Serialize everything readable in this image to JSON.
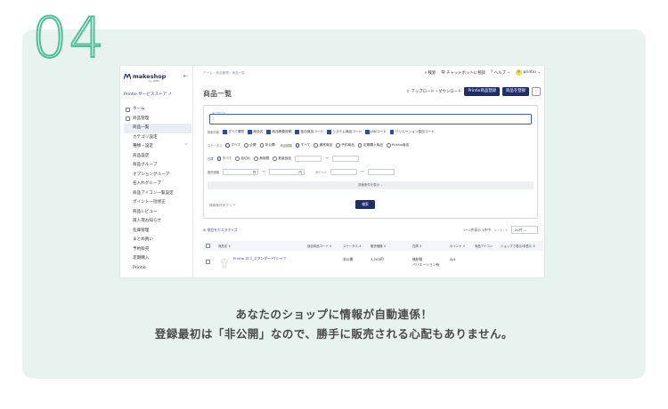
{
  "step": "04",
  "app": {
    "logo": "makeshop",
    "logo_sub": "by GMO",
    "store_link": "Printio サービスストア"
  },
  "sidebar": {
    "home": "ホーム",
    "products": "商品管理",
    "items": [
      "商品一覧",
      "カテゴリ設定",
      "種類・設定",
      "商品設定",
      "商品グループ",
      "オプショングループ",
      "名入れグループ",
      "商品アイコン一覧設定",
      "ポイント一括修正",
      "商品レビュー",
      "再入荷お知らせ",
      "在庫管理",
      "まとめ買い",
      "予約販売",
      "定期購入",
      "Printio"
    ]
  },
  "header": {
    "breadcrumb": "ホーム  ›  商品管理  ›  商品一覧",
    "search": "検索",
    "chat": "チャットボットに相談",
    "help": "ヘルプ",
    "user_initial": "P",
    "user": "printio"
  },
  "page": {
    "title": "商品一覧",
    "upload": "アップロード・ダウンロード",
    "printio_btn": "Printio商品登録",
    "new_btn": "商品を登録"
  },
  "filters": {
    "keyword_legend": "キーワード",
    "keyword_value": "|",
    "target_label": "検索対象",
    "targets": [
      "すべて選択",
      "商品名",
      "商品概要説明",
      "独自商品コード",
      "システム商品コード",
      "JANコード",
      "バリエーション独自コード"
    ],
    "status_label": "ステータス",
    "status_opts": [
      "すべて",
      "公開",
      "非公開"
    ],
    "type_label": "商品種類",
    "type_opts": [
      "すべて",
      "通常商品",
      "予約商品",
      "定期購入商品",
      "Printio商品"
    ],
    "stock_label": "在庫",
    "stock_opts": [
      "すべて",
      "品切れ",
      "無制限",
      "数量指定"
    ],
    "price_label": "販売価格",
    "yen": "円",
    "tilde": "〜",
    "point_label": "ポイント",
    "more": "詳細条件を表示  ⌄",
    "clear": "検索条件をクリア",
    "search_btn": "検索"
  },
  "table": {
    "customize": "項目をカスタマイズ",
    "count": "1〜1件表示  1件中",
    "pages": "«  ‹  1  ›  »",
    "per_page": "20件",
    "columns": [
      "商品名 ⇕",
      "独自商品コード ⇕",
      "ステータス ⇕",
      "販売価格 ⇕",
      "在庫 ⇕",
      "ポイント ⇕",
      "商品アイコン",
      "ショップで表示/非表示 ⇕"
    ],
    "rows": [
      {
        "name": "Printio ロゴ_スタンダードTシャツ",
        "code": "",
        "status": "非公開",
        "price": "3,200円",
        "stock": "無制限\nバリエーション有",
        "point": "0pt"
      }
    ]
  },
  "caption": {
    "line1": "あなたのショップに情報が自動連係！",
    "line2": "登録最初は「非公開」なので、勝手に販売される心配もありません。"
  }
}
